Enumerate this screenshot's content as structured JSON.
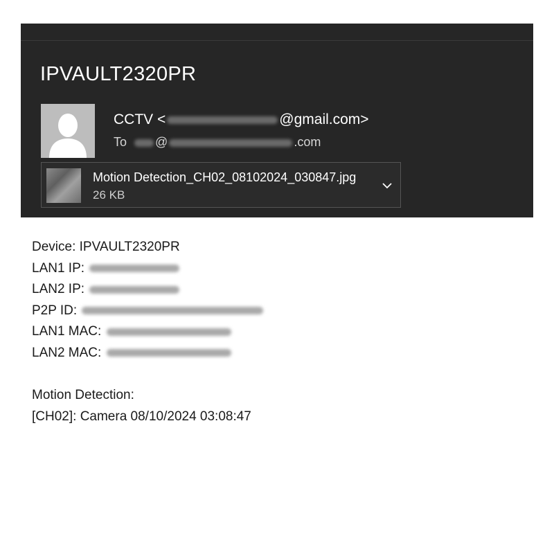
{
  "email": {
    "subject": "IPVAULT2320PR",
    "sender_name": "CCTV",
    "sender_prefix": "<",
    "sender_domain": "@gmail.com>",
    "to_label": "To",
    "to_at": "@",
    "to_suffix": ".com"
  },
  "attachment": {
    "filename": "Motion Detection_CH02_08102024_030847.jpg",
    "size": "26 KB"
  },
  "body": {
    "device": "Device: IPVAULT2320PR",
    "lan1_ip_label": "LAN1 IP:",
    "lan2_ip_label": "LAN2 IP:",
    "p2p_label": "P2P ID:",
    "lan1_mac_label": "LAN1 MAC:",
    "lan2_mac_label": "LAN2 MAC:",
    "motion_title": "Motion Detection:",
    "motion_event": "[CH02]: Camera 08/10/2024 03:08:47"
  },
  "icons": {
    "avatar": "default-user-avatar-icon",
    "expand": "chevron-down-icon",
    "thumbnail": "image-thumbnail"
  },
  "colors": {
    "header_bg": "#262626",
    "text_light": "#ffffff",
    "body_text": "#1a1a1a"
  }
}
